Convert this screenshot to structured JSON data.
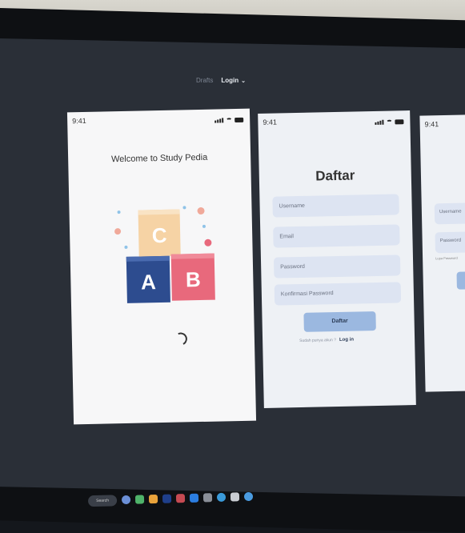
{
  "topnav": {
    "drafts": "Drafts",
    "page": "Login"
  },
  "frames": {
    "splash": {
      "time": "9:41",
      "welcome": "Welcome to Study Pedia",
      "blocks": {
        "c": "C",
        "a": "A",
        "b": "B"
      }
    },
    "register": {
      "time": "9:41",
      "title": "Daftar",
      "fields": [
        "Username",
        "Email",
        "Password",
        "Konfirmasi Password"
      ],
      "button": "Daftar",
      "footer_text": "Sudah punya akun ?",
      "footer_link": "Log in"
    },
    "login": {
      "time": "9:41",
      "fields": [
        "Username",
        "Password"
      ],
      "forgot": "Lupa Password"
    }
  },
  "taskbar": {
    "search": "Search"
  },
  "colors": {
    "accent": "#9bb8e0",
    "field_bg": "#dde4f2",
    "screen_bg": "#2a2f37"
  }
}
